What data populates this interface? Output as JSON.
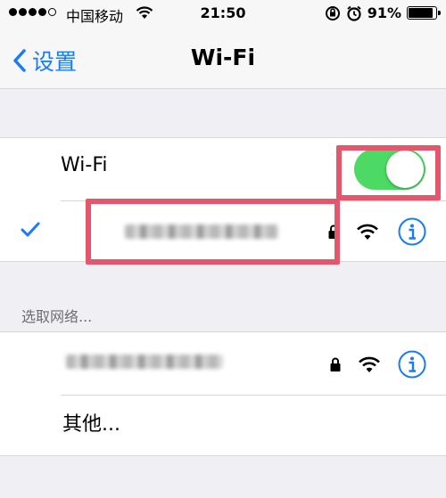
{
  "status_bar": {
    "carrier": "中国移动",
    "time": "21:50",
    "battery_percent": "91%",
    "battery_level": 0.91
  },
  "nav": {
    "back_label": "设置",
    "title": "Wi-Fi"
  },
  "wifi_toggle": {
    "label": "Wi-Fi",
    "on": true
  },
  "section_header": "选取网络...",
  "other_network_label": "其他...",
  "colors": {
    "accent": "#1a7cf3",
    "toggle_on": "#4cd964",
    "highlight": "#e4566b",
    "background": "#efeff4"
  },
  "icons": [
    "chevron-left-icon",
    "checkmark-icon",
    "lock-icon",
    "wifi-signal-icon",
    "info-icon",
    "alarm-icon",
    "rotation-lock-icon"
  ]
}
